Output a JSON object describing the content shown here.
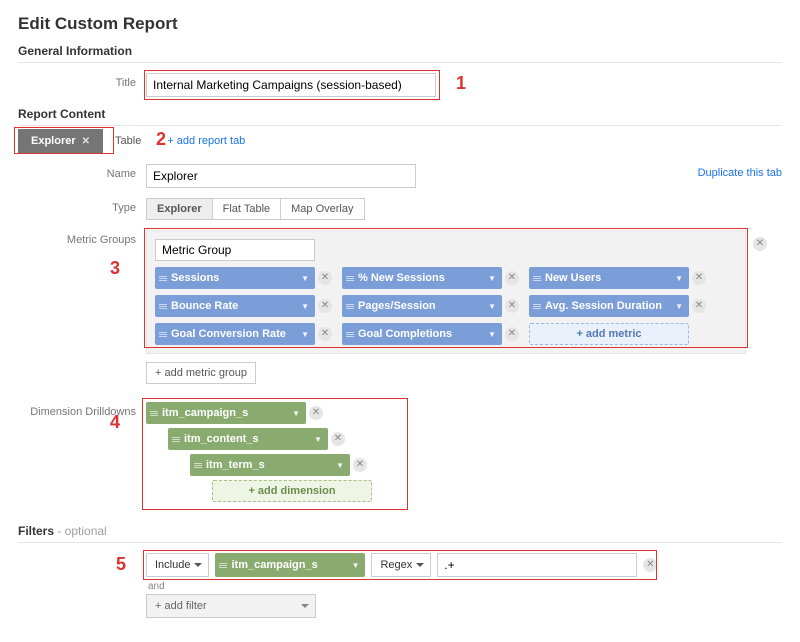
{
  "page_title": "Edit Custom Report",
  "sections": {
    "general": "General Information",
    "content": "Report Content",
    "filters": "Filters",
    "filters_optional": " - optional"
  },
  "labels": {
    "title": "Title",
    "name": "Name",
    "type": "Type",
    "metric_groups": "Metric Groups",
    "dimension_drilldowns": "Dimension Drilldowns"
  },
  "title_value": "Internal Marketing Campaigns (session-based)",
  "tabs": {
    "explorer": "Explorer",
    "table": "Table",
    "add": "+ add report tab"
  },
  "name_value": "Explorer",
  "duplicate": "Duplicate this tab",
  "type_buttons": {
    "explorer": "Explorer",
    "flat": "Flat Table",
    "map": "Map Overlay"
  },
  "metric_group": {
    "name": "Metric Group",
    "metrics": [
      [
        "Sessions",
        "% New Sessions",
        "New Users"
      ],
      [
        "Bounce Rate",
        "Pages/Session",
        "Avg. Session Duration"
      ],
      [
        "Goal Conversion Rate",
        "Goal Completions"
      ]
    ],
    "add_metric": "+ add metric",
    "add_group": "+ add metric group"
  },
  "drilldowns": {
    "items": [
      "itm_campaign_s",
      "itm_content_s",
      "itm_term_s"
    ],
    "add": "+ add dimension"
  },
  "filters": {
    "include": "Include",
    "dimension": "itm_campaign_s",
    "match": "Regex",
    "value": ".+",
    "and": "and",
    "add": "+ add filter"
  },
  "annotations": {
    "a1": "1",
    "a2": "2",
    "a3": "3",
    "a4": "4",
    "a5": "5"
  }
}
